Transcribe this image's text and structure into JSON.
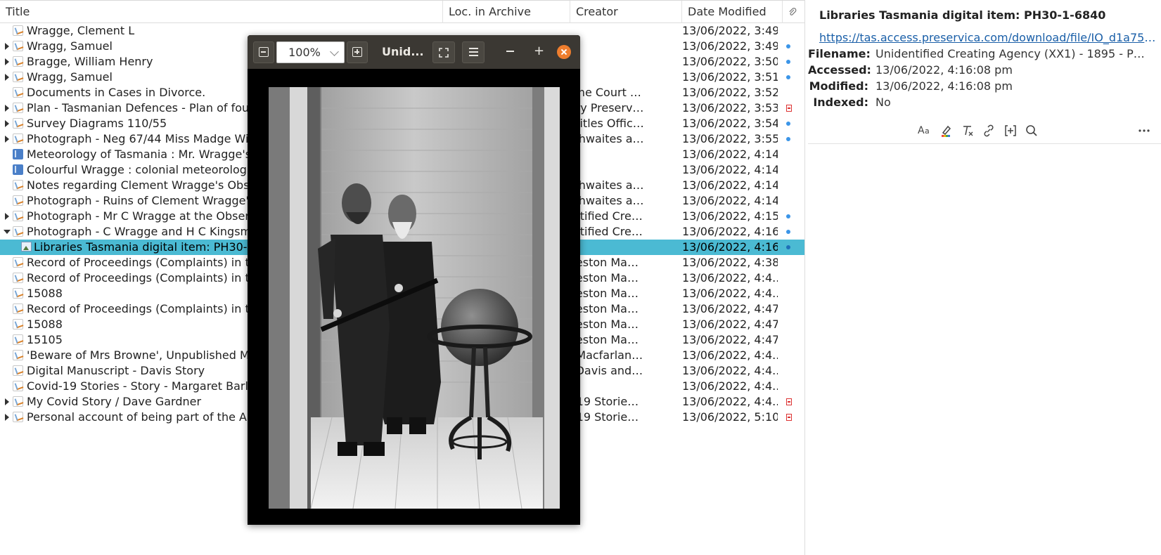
{
  "columns": {
    "title": "Title",
    "loc": "Loc. in Archive",
    "creator": "Creator",
    "date": "Date Modified"
  },
  "rows": [
    {
      "twisty": "none",
      "icon": "manuscript",
      "title": "Wragge, Clement L",
      "creator": "",
      "date": "13/06/2022, 3:49...",
      "attach": "none"
    },
    {
      "twisty": "closed",
      "icon": "manuscript",
      "title": "Wragg, Samuel",
      "creator": "",
      "date": "13/06/2022, 3:49...",
      "attach": "dot"
    },
    {
      "twisty": "closed",
      "icon": "manuscript",
      "title": "Bragge, William Henry",
      "creator": "",
      "date": "13/06/2022, 3:50...",
      "attach": "dot"
    },
    {
      "twisty": "closed",
      "icon": "manuscript",
      "title": "Wragg, Samuel",
      "creator": "",
      "date": "13/06/2022, 3:51:...",
      "attach": "dot"
    },
    {
      "twisty": "none",
      "icon": "manuscript",
      "title": "Documents in Cases in Divorce.",
      "creator": "upreme Court (R...",
      "date": "13/06/2022, 3:52...",
      "attach": "none"
    },
    {
      "twisty": "closed",
      "icon": "manuscript",
      "title": "Plan - Tasmanian Defences - Plan of foun",
      "creator": "cenery Preservat...",
      "date": "13/06/2022, 3:53...",
      "attach": "pdf"
    },
    {
      "twisty": "closed",
      "icon": "manuscript",
      "title": "Survey Diagrams 110/55",
      "creator": "and Titles Office ...",
      "date": "13/06/2022, 3:54...",
      "attach": "dot"
    },
    {
      "twisty": "closed",
      "icon": "manuscript",
      "title": "Photograph - Neg 67/44 Miss Madge Wilso",
      "creator": "ack Thwaites and...",
      "date": "13/06/2022, 3:55...",
      "attach": "dot"
    },
    {
      "twisty": "none",
      "icon": "book",
      "title": "Meteorology of Tasmania : Mr. Wragge's re",
      "creator": "",
      "date": "13/06/2022, 4:14...",
      "attach": "none"
    },
    {
      "twisty": "none",
      "icon": "book",
      "title": "Colourful Wragge : colonial meteorologist",
      "creator": "",
      "date": "13/06/2022, 4:14...",
      "attach": "none"
    },
    {
      "twisty": "none",
      "icon": "manuscript",
      "title": "Notes regarding Clement Wragge's Observ",
      "creator": "ack Thwaites and...",
      "date": "13/06/2022, 4:14...",
      "attach": "none"
    },
    {
      "twisty": "none",
      "icon": "manuscript",
      "title": "Photograph - Ruins of Clement Wragge's w",
      "creator": "ack Thwaites and...",
      "date": "13/06/2022, 4:14...",
      "attach": "none"
    },
    {
      "twisty": "closed",
      "icon": "manuscript",
      "title": "Photograph - Mr C Wragge at the Observat",
      "creator": "nidentified Crea...",
      "date": "13/06/2022, 4:15...",
      "attach": "dot"
    },
    {
      "twisty": "open",
      "icon": "manuscript",
      "title": "Photograph - C Wragge and H C Kingsmill,",
      "creator": "nidentified Crea...",
      "date": "13/06/2022, 4:16...",
      "attach": "dot"
    },
    {
      "twisty": "none",
      "icon": "image",
      "child": true,
      "selected": true,
      "title": "Libraries Tasmania digital item: PH30-1-6",
      "creator": "",
      "date": "13/06/2022, 4:16...",
      "attach": "dot"
    },
    {
      "twisty": "none",
      "icon": "manuscript",
      "title": "Record of Proceedings (Complaints) in the",
      "creator": "aunceston Magis...",
      "date": "13/06/2022, 4:38...",
      "attach": "none"
    },
    {
      "twisty": "none",
      "icon": "manuscript",
      "title": "Record of Proceedings (Complaints) in the",
      "creator": "aunceston Magis...",
      "date": "13/06/2022, 4:4...",
      "attach": "none"
    },
    {
      "twisty": "none",
      "icon": "manuscript",
      "title": "15088",
      "creator": "aunceston Magis...",
      "date": "13/06/2022, 4:4...",
      "attach": "none"
    },
    {
      "twisty": "none",
      "icon": "manuscript",
      "title": "Record of Proceedings (Complaints) in the",
      "creator": "aunceston Magis...",
      "date": "13/06/2022, 4:47...",
      "attach": "none"
    },
    {
      "twisty": "none",
      "icon": "manuscript",
      "title": "15088",
      "creator": "aunceston Magis...",
      "date": "13/06/2022, 4:47...",
      "attach": "none"
    },
    {
      "twisty": "none",
      "icon": "manuscript",
      "title": "15105",
      "creator": "aunceston Magis...",
      "date": "13/06/2022, 4:47...",
      "attach": "none"
    },
    {
      "twisty": "none",
      "icon": "manuscript",
      "title": "'Beware of Mrs Browne', Unpublished Man",
      "creator": "iona Macfarlane ...",
      "date": "13/06/2022, 4:4...",
      "attach": "none"
    },
    {
      "twisty": "none",
      "icon": "manuscript",
      "title": "Digital Manuscript - Davis Story",
      "creator": "scar Davis and F...",
      "date": "13/06/2022, 4:4...",
      "attach": "none"
    },
    {
      "twisty": "none",
      "icon": "manuscript",
      "title": "Covid-19 Stories - Story - Margaret Barlow",
      "creator": "",
      "date": "13/06/2022, 4:4...",
      "attach": "none"
    },
    {
      "twisty": "closed",
      "icon": "manuscript",
      "title": "My Covid Story / Dave Gardner",
      "creator": "ovid-19 Stories P...",
      "date": "13/06/2022, 4:4...",
      "attach": "pdf"
    },
    {
      "twisty": "closed",
      "icon": "manuscript",
      "title": "Personal account of being part of the Aus",
      "creator": "ovid-19 Stories P...",
      "date": "13/06/2022, 5:10...",
      "attach": "pdf"
    }
  ],
  "viewer": {
    "zoom": "100%",
    "title": "Unid..."
  },
  "item": {
    "heading": "Libraries Tasmania digital item: PH30-1-6840",
    "url": "https://tas.access.preservica.com/download/file/IO_d1a75d...",
    "fields": [
      {
        "label": "Filename:",
        "value": "Unidentified Creating Agency (XX1) - 1895 - Photogr..."
      },
      {
        "label": "Accessed:",
        "value": "13/06/2022, 4:16:08 pm"
      },
      {
        "label": "Modified:",
        "value": "13/06/2022, 4:16:08 pm"
      },
      {
        "label": "Indexed:",
        "value": "No"
      }
    ]
  },
  "colors": {
    "selection": "#4bbad3",
    "link": "#1a5fa8",
    "close_button": "#ef7e2e",
    "attachment_dot": "#3b95e8"
  },
  "icons": {
    "attachment_column": "paperclip-icon",
    "note_toolbar": [
      "text-format-icon",
      "highlight-icon",
      "clear-format-icon",
      "link-icon",
      "insert-citation-icon",
      "search-icon",
      "more-icon"
    ]
  }
}
